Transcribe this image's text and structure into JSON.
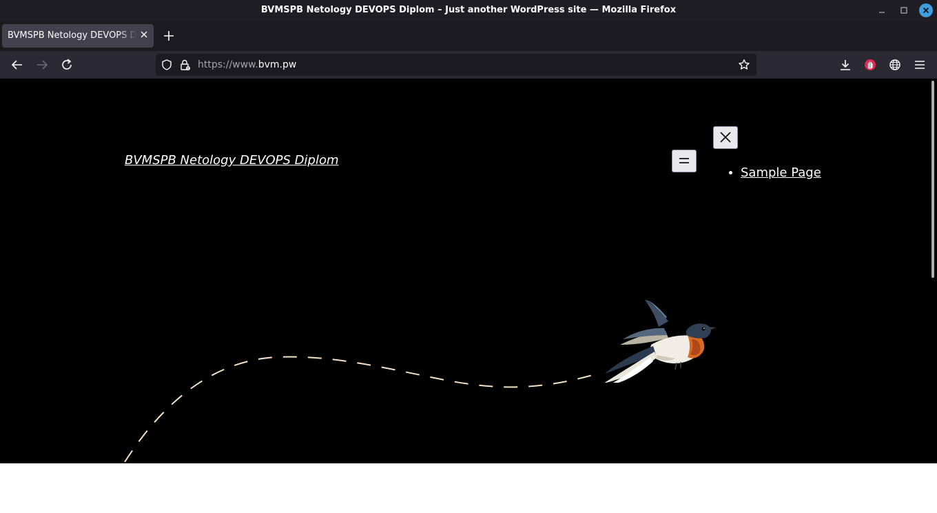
{
  "window": {
    "title": "BVMSPB Netology DEVOPS Diplom – Just another WordPress site — Mozilla Firefox"
  },
  "tabs": [
    {
      "label": "BVMSPB Netology DEVOPS Diplom – Just another WordPress site",
      "active": true
    }
  ],
  "toolbar": {
    "url_prefix": "https://www.",
    "url_domain": "bvm.pw",
    "icons": [
      "back-icon",
      "forward-icon",
      "reload-icon",
      "shield-icon",
      "lock-icon",
      "bookmark-star-icon",
      "downloads-icon",
      "extension-icon",
      "globe-icon",
      "menu-icon"
    ]
  },
  "page": {
    "site_title": "BVMSPB Netology DEVOPS Diplom",
    "nav_items": [
      "Sample Page"
    ]
  },
  "colors": {
    "page_background": "#000000",
    "path_stroke": "#f4e3c8",
    "button_background": "#e9e9ed",
    "extension_red": "#e22850"
  }
}
